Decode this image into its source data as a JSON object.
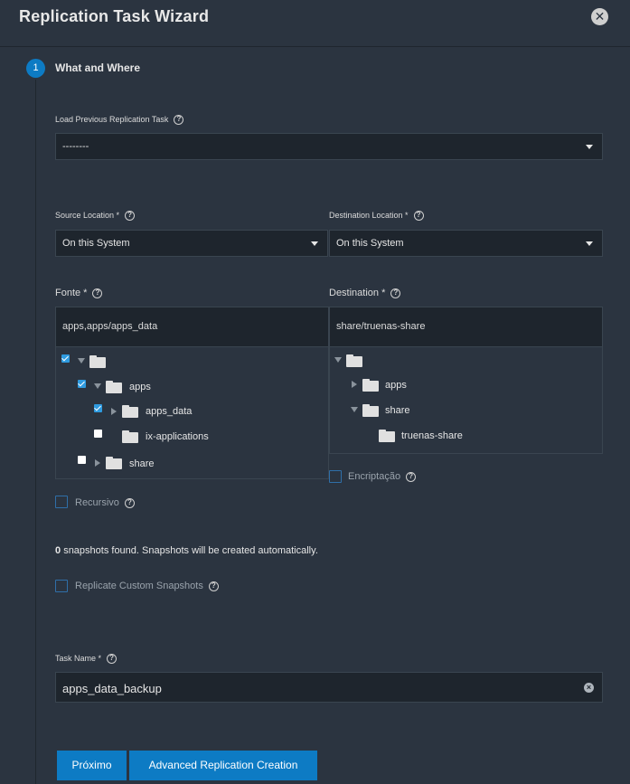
{
  "dialog": {
    "title": "Replication Task Wizard",
    "close_icon": "close-icon"
  },
  "step": {
    "number": "1",
    "title": "What and Where"
  },
  "load_previous": {
    "label": "Load Previous Replication Task",
    "value": "--------"
  },
  "source_location": {
    "label": "Source Location *",
    "value": "On this System"
  },
  "destination_location": {
    "label": "Destination Location *",
    "value": "On this System"
  },
  "source": {
    "label": "Fonte *",
    "path": "apps,apps/apps_data",
    "tree": [
      {
        "label": "",
        "checked": true
      },
      {
        "label": "apps",
        "checked": true
      },
      {
        "label": "apps_data",
        "checked": true
      },
      {
        "label": "ix-applications",
        "checked": false
      },
      {
        "label": "share",
        "checked": false
      }
    ],
    "recursive_label": "Recursivo"
  },
  "destination": {
    "label": "Destination *",
    "path": "share/truenas-share",
    "tree": [
      {
        "label": ""
      },
      {
        "label": "apps"
      },
      {
        "label": "share"
      },
      {
        "label": "truenas-share"
      }
    ],
    "encryption_label": "Encriptação"
  },
  "snapshots": {
    "count": "0",
    "text": "snapshots found. Snapshots will be created automatically."
  },
  "replicate_custom": {
    "label": "Replicate Custom Snapshots"
  },
  "task_name": {
    "label": "Task Name *",
    "value": "apps_data_backup"
  },
  "buttons": {
    "next": "Próximo",
    "advanced": "Advanced Replication Creation"
  },
  "colors": {
    "accent": "#0d7bc4",
    "background": "#2b3440",
    "field": "#1e252d"
  }
}
